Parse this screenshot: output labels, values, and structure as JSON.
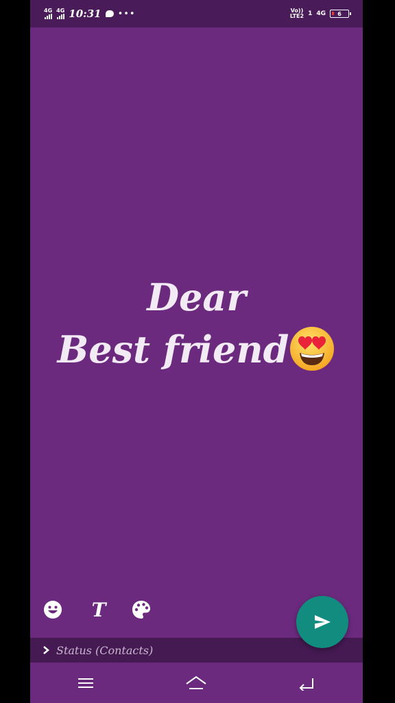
{
  "status_bar": {
    "sim1_network": "4G",
    "sim2_network": "4G",
    "time": "10:31",
    "more_dots": "•••",
    "volte_top": "Vo))",
    "volte_bottom": "LTE2",
    "sim_indicator": "1",
    "right_network": "4G",
    "battery_level": "6"
  },
  "message": {
    "line1": "Dear",
    "line2": "Best friend",
    "emoji": "smiling-face-with-heart-eyes"
  },
  "audience": {
    "label": "Status (Contacts)"
  },
  "colors": {
    "background": "#6c2a7e",
    "status_bar": "#4a1b59",
    "send_button": "#128c7e",
    "audience_bar": "#451a53"
  }
}
